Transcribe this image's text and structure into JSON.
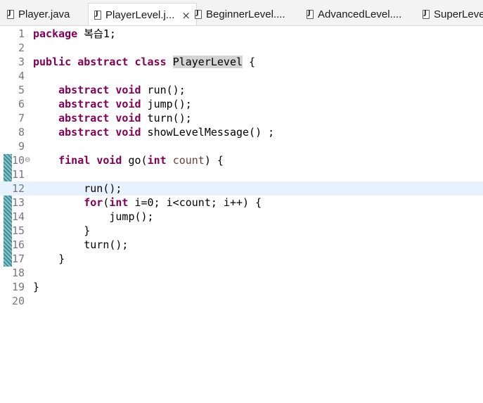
{
  "tabs": [
    {
      "label": "Player.java",
      "icon": "java-file-icon",
      "active": false
    },
    {
      "label": "PlayerLevel.j...",
      "icon": "java-file-icon",
      "active": true,
      "close": "×"
    },
    {
      "label": "BeginnerLevel....",
      "icon": "java-file-icon",
      "active": false
    },
    {
      "label": "AdvancedLevel....",
      "icon": "java-file-icon",
      "active": false
    },
    {
      "label": "SuperLeve",
      "icon": "java-file-icon",
      "active": false
    }
  ],
  "code": {
    "current_line": 12,
    "changed_lines": "10-17",
    "lines": [
      {
        "n": "1",
        "t": "package 복습1;"
      },
      {
        "n": "2",
        "t": ""
      },
      {
        "n": "3",
        "t": "public abstract class PlayerLevel {"
      },
      {
        "n": "4",
        "t": ""
      },
      {
        "n": "5",
        "t": "    abstract void run();"
      },
      {
        "n": "6",
        "t": "    abstract void jump();"
      },
      {
        "n": "7",
        "t": "    abstract void turn();"
      },
      {
        "n": "8",
        "t": "    abstract void showLevelMessage() ;"
      },
      {
        "n": "9",
        "t": ""
      },
      {
        "n": "10",
        "t": "    final void go(int count) {"
      },
      {
        "n": "11",
        "t": ""
      },
      {
        "n": "12",
        "t": "        run();"
      },
      {
        "n": "13",
        "t": "        for(int i=0; i<count; i++) {"
      },
      {
        "n": "14",
        "t": "            jump();"
      },
      {
        "n": "15",
        "t": "        }"
      },
      {
        "n": "16",
        "t": "        turn();"
      },
      {
        "n": "17",
        "t": "    }"
      },
      {
        "n": "18",
        "t": ""
      },
      {
        "n": "19",
        "t": "}"
      },
      {
        "n": "20",
        "t": ""
      }
    ]
  },
  "colors": {
    "keyword": "#7f0055",
    "current_line": "#e8f2fe",
    "line_number": "#787878"
  }
}
